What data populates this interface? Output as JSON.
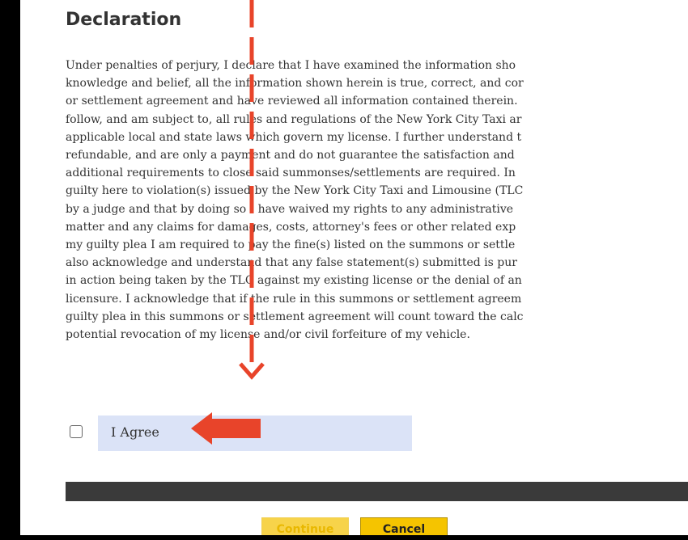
{
  "declaration": {
    "title": "Declaration",
    "lines": [
      "Under penalties of perjury, I declare that I have examined the information sho",
      "knowledge and belief, all the information shown herein is true, correct, and cor",
      "or settlement agreement and have reviewed all information contained therein. ",
      "follow, and am subject to, all rules and regulations of the New York City Taxi ar",
      "applicable local and state laws which govern my license. I further understand t",
      "refundable, and are only a payment and do not guarantee the satisfaction and",
      "additional requirements to close said summonses/settlements are required. In",
      "guilty here to violation(s) issued by the New York City Taxi and Limousine (TLC",
      "by a judge and that by doing so I have waived my rights to any administrative",
      "matter and any claims for damages, costs, attorney's fees or other related exp",
      "my guilty plea I am required to pay the fine(s) listed on the summons or settle",
      "also acknowledge and understand that any false statement(s) submitted is pur",
      "in action being taken by the TLC against my existing license or the denial of an",
      "licensure. I acknowledge that if the rule in this summons or settlement agreem",
      "guilty plea in this summons or settlement agreement will count toward the calc",
      "potential revocation of my license and/or civil forfeiture of my vehicle."
    ]
  },
  "agree": {
    "label": "I Agree",
    "checked": false
  },
  "buttons": {
    "continue_label": "Continue",
    "cancel_label": "Cancel"
  },
  "colors": {
    "annotation": "#e8442a",
    "agree_highlight": "#dbe3f7",
    "button_yellow": "#f5c400",
    "dark_bar": "#3a3a3a"
  },
  "icons": [
    "checkbox-icon",
    "annotation-arrow-icon"
  ]
}
